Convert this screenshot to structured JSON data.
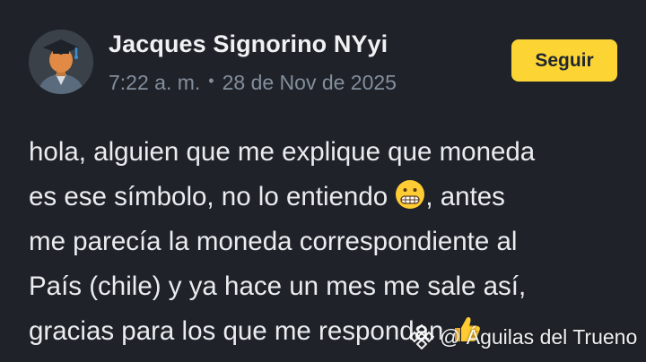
{
  "post": {
    "author_name": "Jacques Signorino NYyi",
    "time": "7:22 a. m.",
    "separator": "•",
    "date": "28 de Nov de 2025",
    "follow_label": "Seguir",
    "body_lines": [
      "hola, alguien que me explique que moneda",
      "es ese símbolo, no lo entiendo ",
      ", antes",
      "me parecía la moneda correspondiente al",
      "País (chile) y ya hace un mes me sale así,",
      "gracias para los que me respondan "
    ],
    "emojis": [
      "grimacing-face-icon",
      "thumbs-up-icon"
    ]
  },
  "watermark": {
    "text": "@ Águilas del Trueno",
    "logo": "binance-logo-icon"
  },
  "colors": {
    "background": "#1f2329",
    "accent": "#fcd535",
    "muted": "#848e9c",
    "text": "#eaecef"
  }
}
